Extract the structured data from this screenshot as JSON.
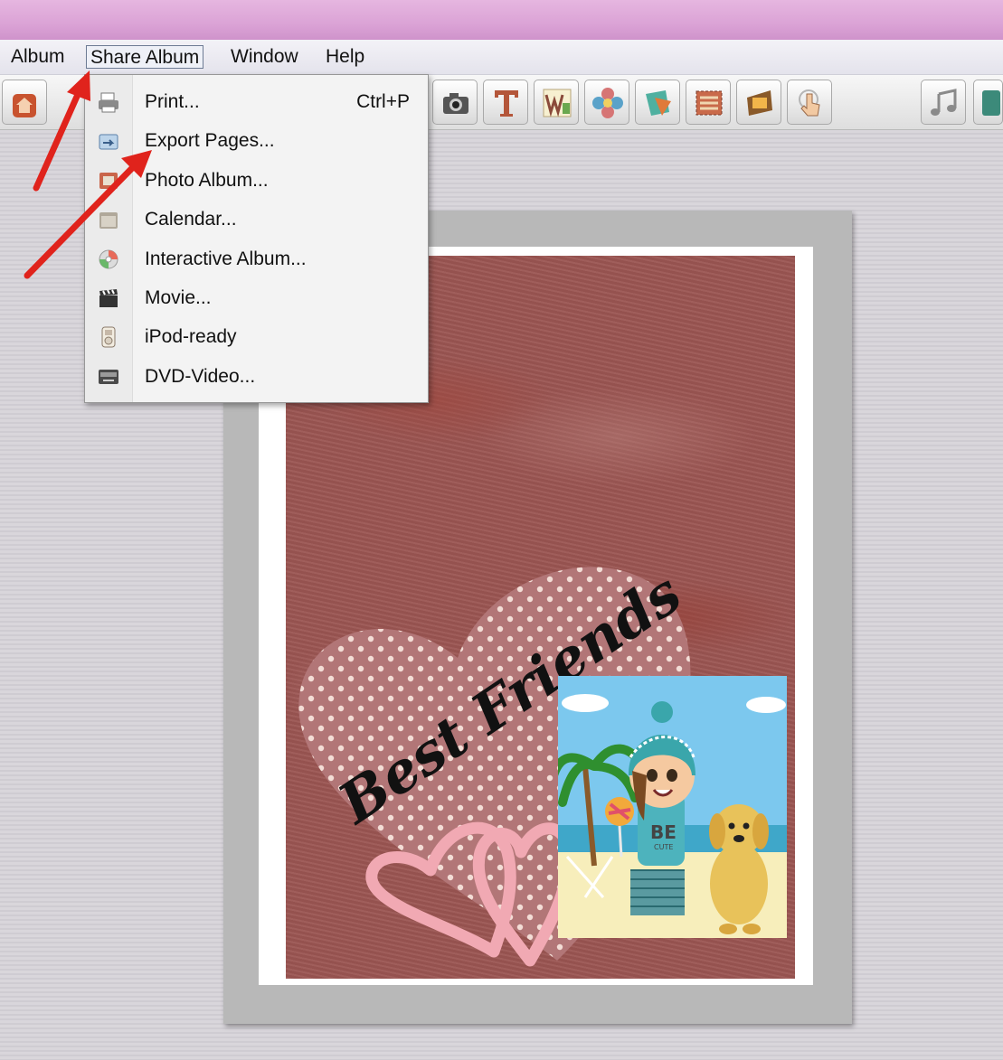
{
  "menubar": {
    "items": [
      {
        "label": "Album"
      },
      {
        "label": "Share Album"
      },
      {
        "label": "Window"
      },
      {
        "label": "Help"
      }
    ]
  },
  "share_menu": {
    "items": [
      {
        "label": "Print...",
        "shortcut": "Ctrl+P",
        "icon": "printer-icon"
      },
      {
        "label": "Export Pages...",
        "icon": "export-icon"
      },
      {
        "label": "Photo Album...",
        "icon": "photo-album-icon"
      },
      {
        "label": "Calendar...",
        "icon": "calendar-icon"
      },
      {
        "label": "Interactive Album...",
        "icon": "cd-icon"
      },
      {
        "label": "Movie...",
        "icon": "clapperboard-icon"
      },
      {
        "label": "iPod-ready",
        "icon": "ipod-icon"
      },
      {
        "label": "DVD-Video...",
        "icon": "dvd-icon"
      }
    ]
  },
  "toolbar": {
    "buttons": [
      "home-icon",
      "camera-icon",
      "text-icon",
      "wordart-icon",
      "flower-icon",
      "shape-icon",
      "stamp-icon",
      "filmstrip-icon",
      "touch-icon",
      "music-icon",
      "more-icon"
    ]
  },
  "page": {
    "title_text": "Best Friends",
    "shirt_text": "BE",
    "shirt_subtext": "CUTE"
  },
  "colors": {
    "titlebar": "#dba3d6",
    "arrow": "#e0231c",
    "page_background": "#9b5552"
  }
}
